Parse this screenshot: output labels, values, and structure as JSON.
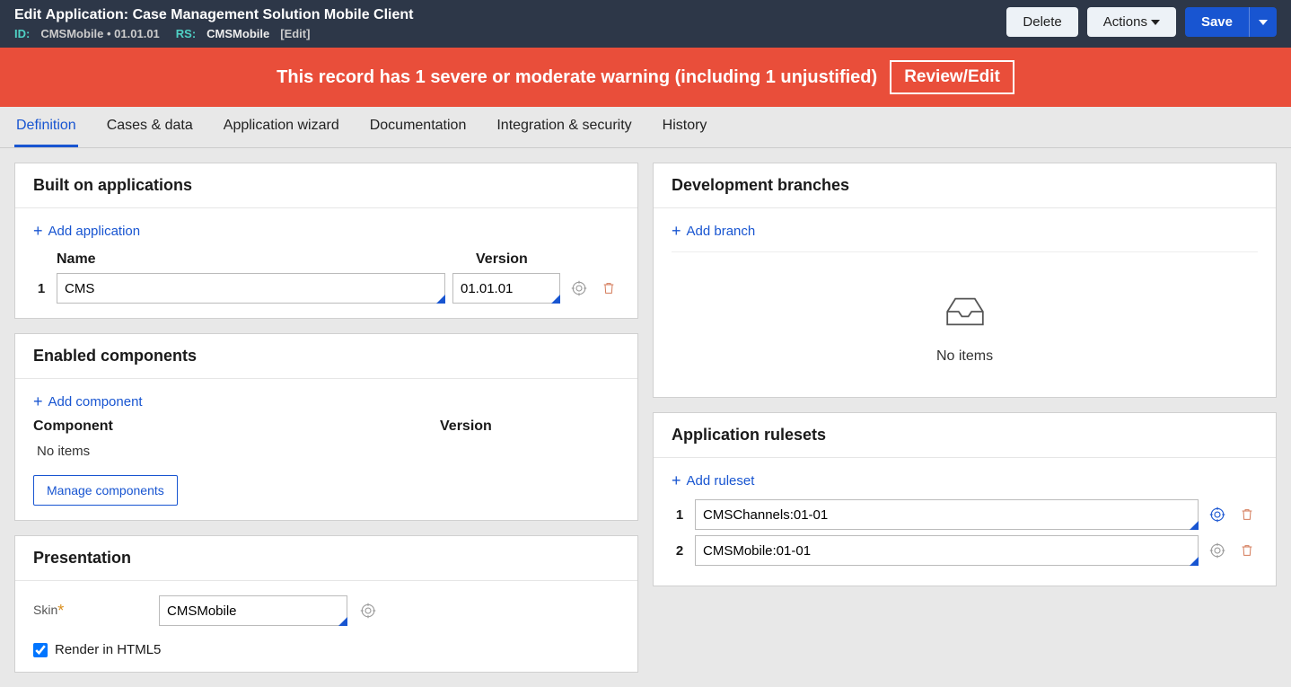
{
  "header": {
    "edit_label": "Edit",
    "title_prefix": "Application:",
    "title_name": "Case Management Solution Mobile Client",
    "id_label": "ID:",
    "id_value": "CMSMobile • 01.01.01",
    "rs_label": "RS:",
    "rs_value": "CMSMobile",
    "edit_link": "[Edit]",
    "delete_label": "Delete",
    "actions_label": "Actions",
    "save_label": "Save"
  },
  "warning": {
    "text": "This record has 1 severe or moderate warning (including 1 unjustified)",
    "review_label": "Review/Edit"
  },
  "tabs": {
    "definition": "Definition",
    "cases": "Cases & data",
    "wizard": "Application wizard",
    "docs": "Documentation",
    "integration": "Integration & security",
    "history": "History"
  },
  "built_on": {
    "title": "Built on applications",
    "add_label": "Add application",
    "col_name": "Name",
    "col_version": "Version",
    "rows": [
      {
        "num": "1",
        "name": "CMS",
        "version": "01.01.01"
      }
    ]
  },
  "components": {
    "title": "Enabled components",
    "add_label": "Add component",
    "col_component": "Component",
    "col_version": "Version",
    "no_items": "No items",
    "manage_label": "Manage components"
  },
  "presentation": {
    "title": "Presentation",
    "skin_label": "Skin",
    "skin_value": "CMSMobile",
    "render_label": "Render in HTML5",
    "render_checked": true
  },
  "branches": {
    "title": "Development branches",
    "add_label": "Add branch",
    "no_items": "No items"
  },
  "rulesets": {
    "title": "Application rulesets",
    "add_label": "Add ruleset",
    "rows": [
      {
        "num": "1",
        "value": "CMSChannels:01-01"
      },
      {
        "num": "2",
        "value": "CMSMobile:01-01"
      }
    ]
  }
}
